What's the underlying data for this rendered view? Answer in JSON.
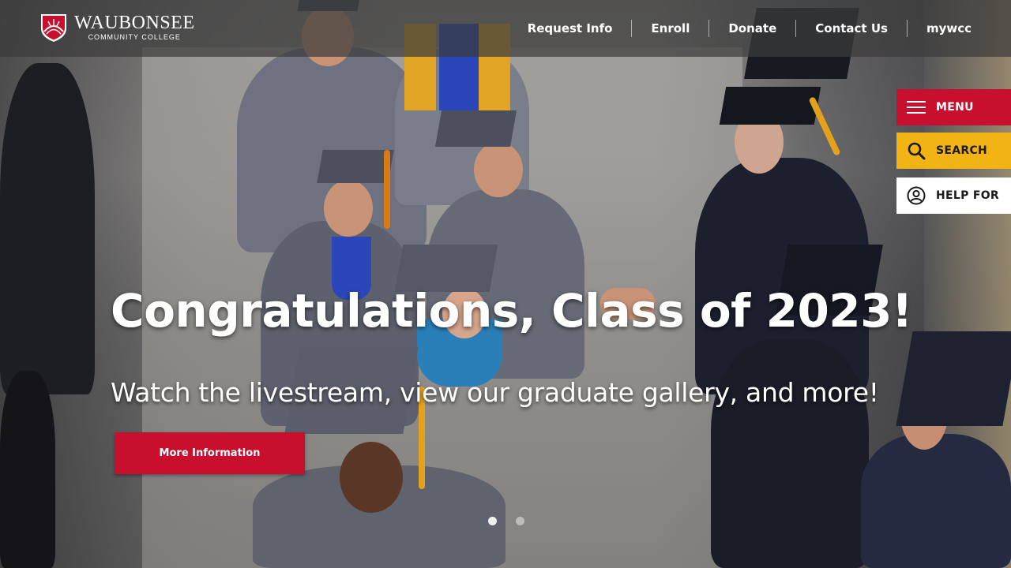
{
  "brand": {
    "name": "WAUBONSEE",
    "subtitle": "COMMUNITY COLLEGE",
    "colors": {
      "red": "#c8102e",
      "gold": "#f2b415"
    }
  },
  "nav": {
    "items": [
      {
        "label": "Request Info"
      },
      {
        "label": "Enroll"
      },
      {
        "label": "Donate"
      },
      {
        "label": "Contact Us"
      },
      {
        "label": "mywcc"
      }
    ]
  },
  "utility": {
    "menu": {
      "label": "MENU",
      "icon": "hamburger-icon"
    },
    "search": {
      "label": "SEARCH",
      "icon": "search-icon"
    },
    "help": {
      "label": "HELP FOR",
      "icon": "user-circle-icon"
    }
  },
  "hero": {
    "headline": "Congratulations, Class of 2023!",
    "subline": "Watch the livestream, view our graduate gallery, and more!",
    "cta_label": "More Information",
    "slides": {
      "count": 2,
      "active": 1
    }
  }
}
